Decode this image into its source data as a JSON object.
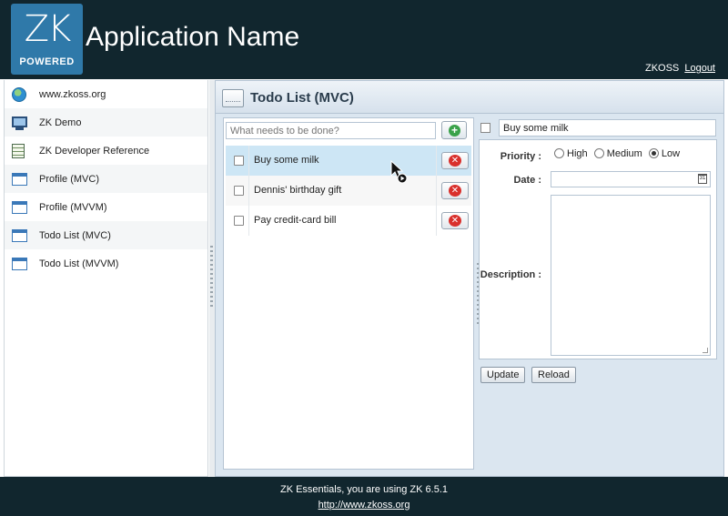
{
  "header": {
    "logo_text": "ZK",
    "logo_sub": "POWERED",
    "app_title": "Application Name",
    "user": "ZKOSS",
    "logout_label": "Logout"
  },
  "sidebar": {
    "items": [
      {
        "label": "www.zkoss.org",
        "icon": "globe-icon"
      },
      {
        "label": "ZK Demo",
        "icon": "monitor-icon"
      },
      {
        "label": "ZK Developer Reference",
        "icon": "document-icon"
      },
      {
        "label": "Profile (MVC)",
        "icon": "window-icon"
      },
      {
        "label": "Profile (MVVM)",
        "icon": "window-icon"
      },
      {
        "label": "Todo List (MVC)",
        "icon": "window-icon"
      },
      {
        "label": "Todo List (MVVM)",
        "icon": "window-icon"
      }
    ]
  },
  "main": {
    "title": "Todo List (MVC)",
    "new_todo_placeholder": "What needs to be done?",
    "todos": [
      {
        "label": "Buy some milk",
        "done": false,
        "selected": true
      },
      {
        "label": "Dennis' birthday gift",
        "done": false,
        "selected": false
      },
      {
        "label": "Pay credit-card bill",
        "done": false,
        "selected": false
      }
    ]
  },
  "detail": {
    "name_value": "Buy some milk",
    "priority_label": "Priority :",
    "priority_options": [
      "High",
      "Medium",
      "Low"
    ],
    "priority_selected": "Low",
    "date_label": "Date :",
    "date_value": "",
    "description_label": "Description :",
    "description_value": "",
    "calendar_icon_text": "31",
    "update_label": "Update",
    "reload_label": "Reload"
  },
  "footer": {
    "text": "ZK Essentials, you are using ZK 6.5.1",
    "link": "http://www.zkoss.org"
  },
  "colors": {
    "header_bg": "#11262e",
    "logo_bg": "#2f79a9",
    "selected_row": "#cde6f5",
    "panel_bg": "#dbe6f0"
  }
}
